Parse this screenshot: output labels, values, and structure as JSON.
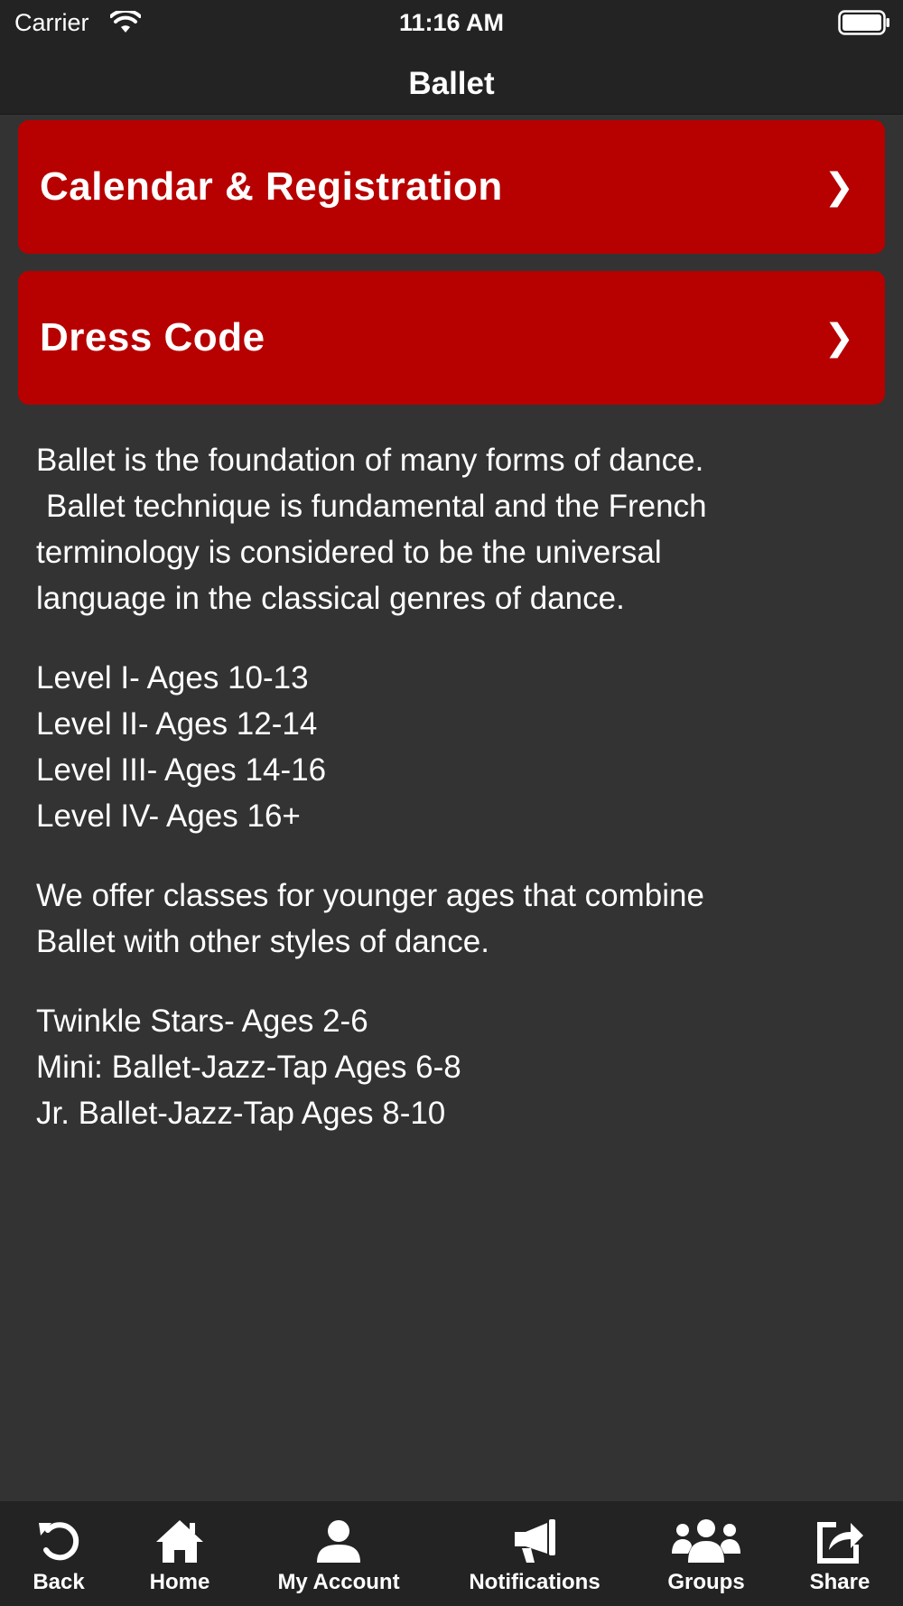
{
  "status_bar": {
    "carrier": "Carrier",
    "time": "11:16 AM",
    "icons": [
      "wifi-icon",
      "battery-icon"
    ]
  },
  "nav": {
    "title": "Ballet"
  },
  "buttons": [
    {
      "label": "Calendar & Registration",
      "icon": "chevron-right-icon",
      "chevron": "❯"
    },
    {
      "label": "Dress Code",
      "icon": "chevron-right-icon",
      "chevron": "❯"
    }
  ],
  "content": {
    "intro_lines": [
      "Ballet is the foundation of many forms of dance.",
      "Ballet technique is fundamental and the French",
      "terminology is considered to be the universal",
      "language in the classical genres of dance."
    ],
    "levels": [
      "Level I- Ages 10-13",
      "Level II- Ages 12-14",
      "Level III- Ages 14-16",
      "Level IV- Ages 16+"
    ],
    "younger_lines": [
      "We offer classes for younger ages that combine",
      "Ballet with other styles of dance."
    ],
    "classes": [
      "Twinkle Stars- Ages 2-6",
      "Mini: Ballet-Jazz-Tap Ages 6-8",
      "Jr. Ballet-Jazz-Tap Ages 8-10"
    ]
  },
  "tab_bar": {
    "items": [
      {
        "label": "Back",
        "icon": "back-arrow-icon"
      },
      {
        "label": "Home",
        "icon": "home-icon"
      },
      {
        "label": "My Account",
        "icon": "user-icon"
      },
      {
        "label": "Notifications",
        "icon": "megaphone-icon"
      },
      {
        "label": "Groups",
        "icon": "group-icon"
      },
      {
        "label": "Share",
        "icon": "share-icon"
      }
    ]
  },
  "colors": {
    "background": "#333333",
    "bar": "#232323",
    "accent_red": "#b70000",
    "text": "#ffffff"
  }
}
